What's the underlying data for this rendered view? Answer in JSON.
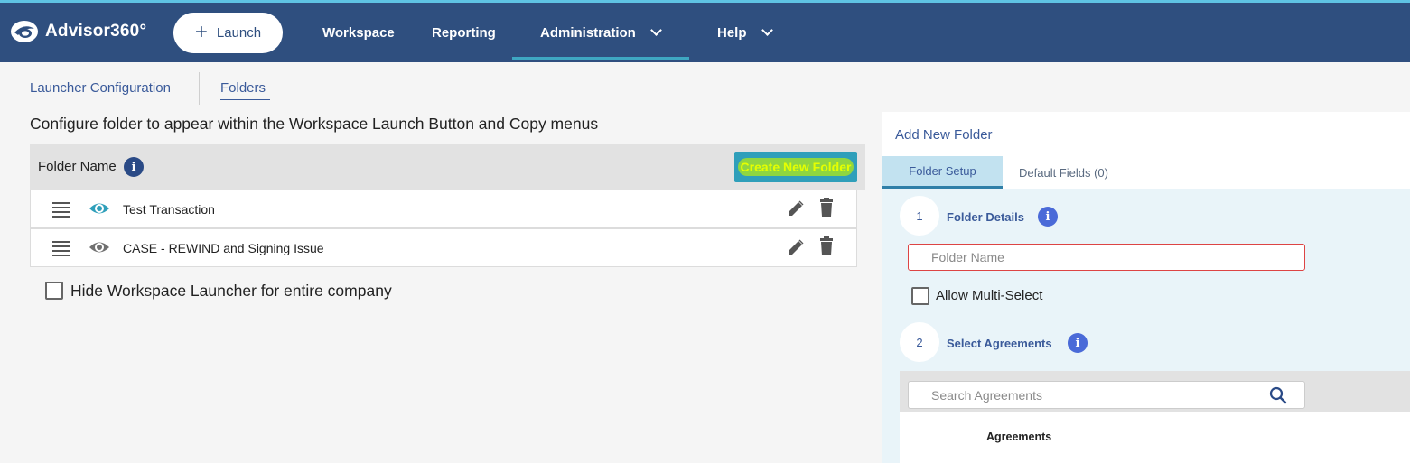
{
  "header": {
    "logo_text": "Advisor360°",
    "launch_label": "Launch",
    "nav": {
      "workspace": "Workspace",
      "reporting": "Reporting",
      "administration": "Administration",
      "help": "Help"
    },
    "colors": {
      "bar": "#2f4f7f",
      "active_underline": "#3ea7c2"
    }
  },
  "subnav": {
    "launcher_configuration": "Launcher Configuration",
    "folders": "Folders"
  },
  "main": {
    "description": "Configure folder to appear within the Workspace Launch Button and Copy menus",
    "table": {
      "column_header": "Folder Name",
      "create_button": "Create New Folder",
      "rows": [
        {
          "name": "Test Transaction",
          "visible": true
        },
        {
          "name": "CASE - REWIND and Signing Issue",
          "visible": false
        }
      ]
    },
    "hide_launcher_label": "Hide Workspace Launcher for entire company"
  },
  "panel": {
    "title": "Add New Folder",
    "tabs": {
      "folder_setup": "Folder Setup",
      "default_fields": "Default Fields (0)"
    },
    "step1": {
      "number": "1",
      "label": "Folder Details"
    },
    "folder_name_placeholder": "Folder Name",
    "allow_multi_select": "Allow Multi-Select",
    "step2": {
      "number": "2",
      "label": "Select Agreements"
    },
    "search_placeholder": "Search Agreements",
    "agreements_header": "Agreements"
  }
}
